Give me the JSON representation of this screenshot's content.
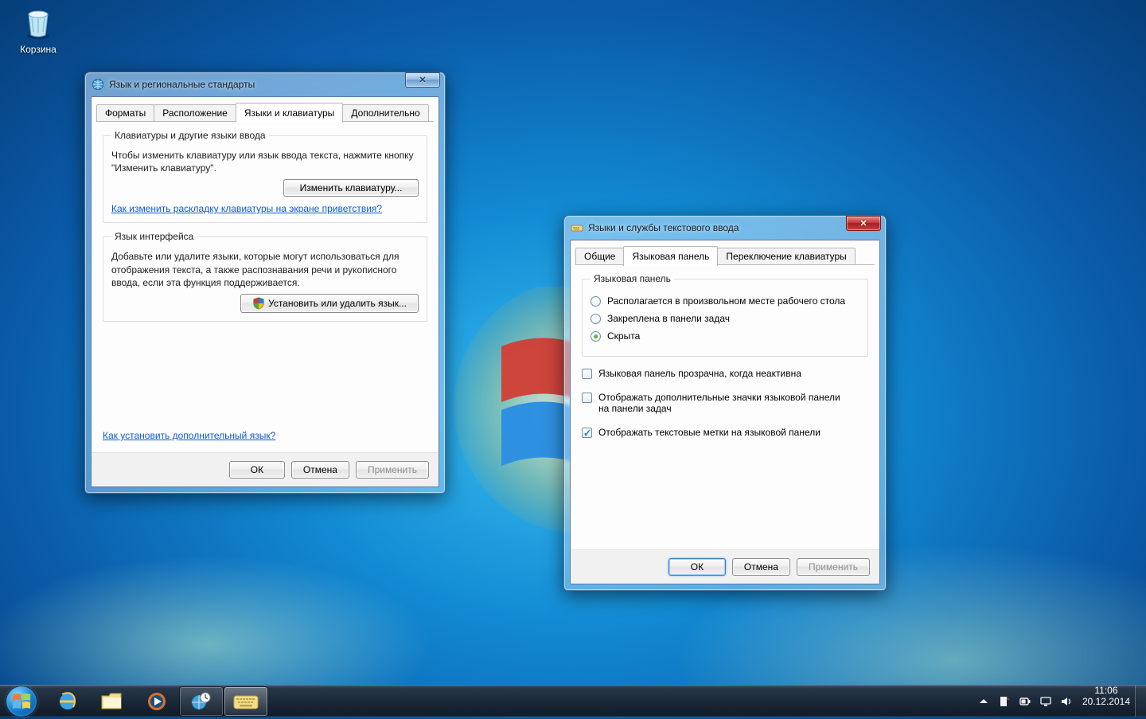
{
  "desktop": {
    "recycle_bin_label": "Корзина"
  },
  "dialog1": {
    "title": "Язык и региональные стандарты",
    "tabs": {
      "formats": "Форматы",
      "location": "Расположение",
      "keyboards": "Языки и клавиатуры",
      "advanced": "Дополнительно",
      "active": "keyboards"
    },
    "group1": {
      "legend": "Клавиатуры и другие языки ввода",
      "text": "Чтобы изменить клавиатуру или язык ввода текста, нажмите кнопку \"Изменить клавиатуру\".",
      "button": "Изменить клавиатуру...",
      "link": "Как изменить раскладку клавиатуры на экране приветствия?"
    },
    "group2": {
      "legend": "Язык интерфейса",
      "text": "Добавьте или удалите языки, которые могут использоваться для отображения текста, а также распознавания речи и рукописного ввода, если эта функция поддерживается.",
      "button": "Установить или удалить язык..."
    },
    "bottom_link": "Как установить дополнительный язык?",
    "buttons": {
      "ok": "ОК",
      "cancel": "Отмена",
      "apply": "Применить"
    }
  },
  "dialog2": {
    "title": "Языки и службы текстового ввода",
    "tabs": {
      "general": "Общие",
      "langbar": "Языковая панель",
      "switching": "Переключение клавиатуры",
      "active": "langbar"
    },
    "panel_group": {
      "legend": "Языковая панель",
      "radio_float": "Располагается в произвольном месте рабочего стола",
      "radio_docked": "Закреплена в панели задач",
      "radio_hidden": "Скрыта",
      "selected": "radio_hidden"
    },
    "checks": {
      "transparent": {
        "label": "Языковая панель прозрачна, когда неактивна",
        "checked": false
      },
      "extra_icons": {
        "label": "Отображать дополнительные значки языковой панели на панели задач",
        "checked": false
      },
      "text_labels": {
        "label": "Отображать текстовые метки на языковой панели",
        "checked": true
      }
    },
    "buttons": {
      "ok": "ОК",
      "cancel": "Отмена",
      "apply": "Применить"
    }
  },
  "taskbar": {
    "time": "11:06",
    "date": "20.12.2014"
  }
}
